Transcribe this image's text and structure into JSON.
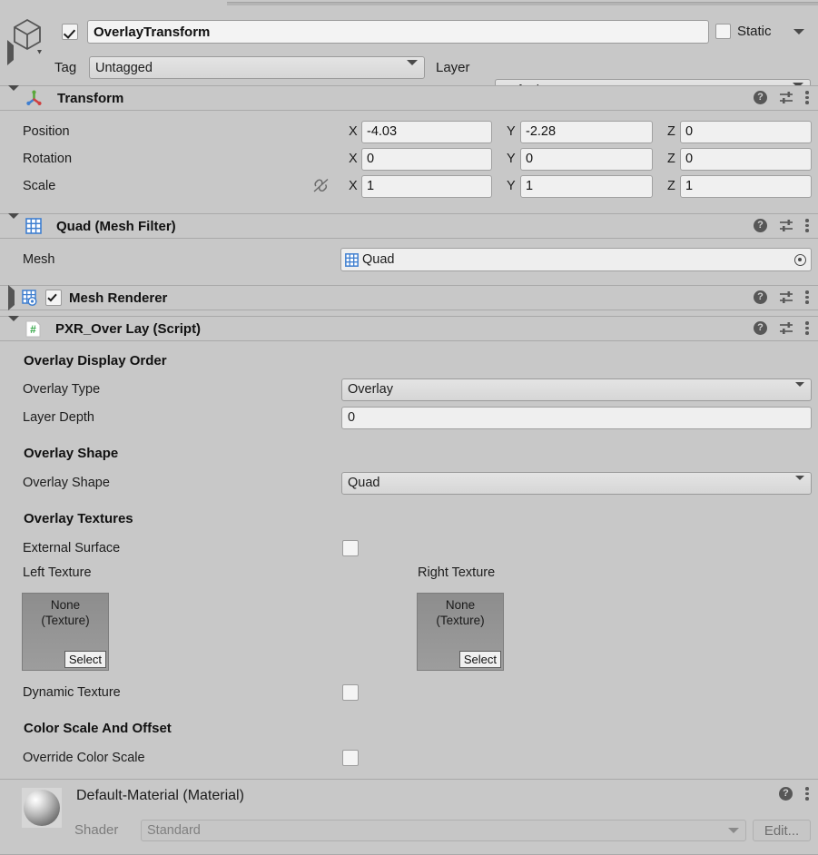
{
  "gameobject": {
    "icon": "cube-icon",
    "enabled_checkbox": true,
    "name": "OverlayTransform",
    "static_label": "Static",
    "tag_label": "Tag",
    "tag_value": "Untagged",
    "layer_label": "Layer",
    "layer_value": "Default"
  },
  "components": [
    {
      "id": "transform",
      "title": "Transform",
      "icon": "transform-axis-icon",
      "expanded": true,
      "rows": [
        {
          "label": "Position",
          "x": "-4.03",
          "y": "-2.28",
          "z": "0"
        },
        {
          "label": "Rotation",
          "x": "0",
          "y": "0",
          "z": "0"
        },
        {
          "label": "Scale",
          "x": "1",
          "y": "1",
          "z": "1",
          "constrain_icon": "constrained-proportions-off-icon"
        }
      ],
      "axis_labels": {
        "x": "X",
        "y": "Y",
        "z": "Z"
      }
    },
    {
      "id": "mesh-filter",
      "title": "Quad (Mesh Filter)",
      "icon": "mesh-filter-icon",
      "expanded": true,
      "mesh_label": "Mesh",
      "mesh_value": "Quad"
    },
    {
      "id": "mesh-renderer",
      "title": "Mesh Renderer",
      "icon": "mesh-renderer-icon",
      "expanded": false,
      "enabled_checkbox": true
    },
    {
      "id": "pxr-overlay",
      "title": "PXR_Over Lay (Script)",
      "icon": "script-icon",
      "expanded": true
    }
  ],
  "overlay": {
    "display_order_title": "Overlay Display Order",
    "overlay_type_label": "Overlay Type",
    "overlay_type_value": "Overlay",
    "layer_depth_label": "Layer Depth",
    "layer_depth_value": "0",
    "shape_title": "Overlay Shape",
    "shape_label": "Overlay Shape",
    "shape_value": "Quad",
    "textures_title": "Overlay Textures",
    "external_surface_label": "External Surface",
    "external_surface_checked": false,
    "left_texture_label": "Left Texture",
    "right_texture_label": "Right Texture",
    "texture_none_line1": "None",
    "texture_none_line2": "(Texture)",
    "select_button_label": "Select",
    "dynamic_texture_label": "Dynamic Texture",
    "dynamic_texture_checked": false,
    "color_scale_title": "Color Scale And Offset",
    "override_color_scale_label": "Override Color Scale",
    "override_color_scale_checked": false
  },
  "material": {
    "title": "Default-Material (Material)",
    "shader_label": "Shader",
    "shader_value": "Standard",
    "edit_label": "Edit..."
  },
  "colors": {
    "background": "#c8c8c8",
    "field": "#f0f0f0",
    "border": "#9b9b9b",
    "accent_blue": "#4a77c4",
    "script_green": "#37a84a"
  }
}
